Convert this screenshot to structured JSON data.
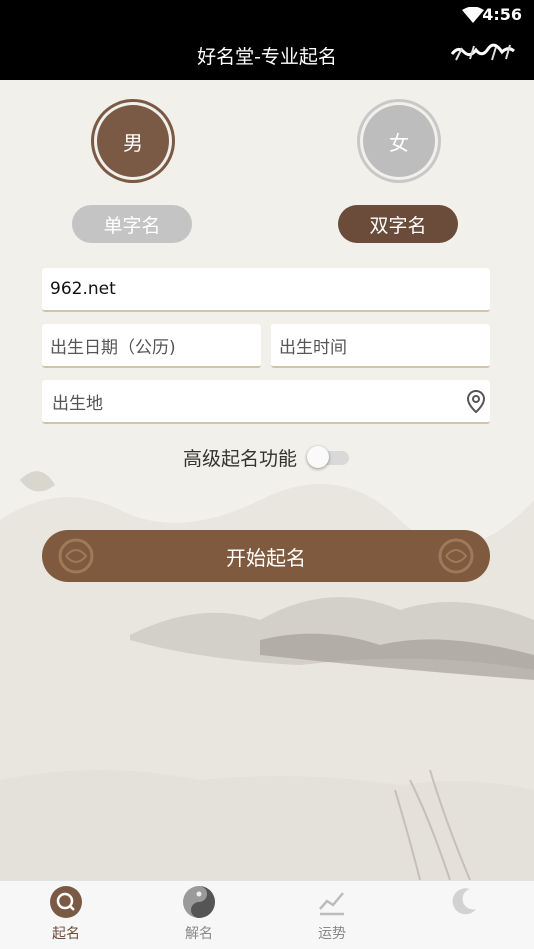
{
  "status_bar": {
    "time": "4:56"
  },
  "header": {
    "title": "好名堂-专业起名"
  },
  "gender": {
    "male": "男",
    "female": "女"
  },
  "name_length": {
    "single": "单字名",
    "double": "双字名"
  },
  "form": {
    "surname_value": "962.net",
    "birth_date_placeholder": "出生日期（公历)",
    "birth_time_placeholder": "出生时间",
    "birth_place_placeholder": "出生地"
  },
  "advanced": {
    "label": "高级起名功能",
    "enabled": false
  },
  "start_button": {
    "label": "开始起名"
  },
  "tabs": [
    {
      "label": "起名",
      "icon": "search-seal-icon",
      "active": true
    },
    {
      "label": "解名",
      "icon": "yin-yang-icon",
      "active": false
    },
    {
      "label": "运势",
      "icon": "trend-chart-icon",
      "active": false
    },
    {
      "label": "",
      "icon": "moon-mark-icon",
      "active": false
    }
  ],
  "colors": {
    "accent_brown": "#6b4c3a",
    "button_brown": "#7f5a3e",
    "inactive_gray": "#c4c4c4",
    "background": "#f2f0ea"
  }
}
